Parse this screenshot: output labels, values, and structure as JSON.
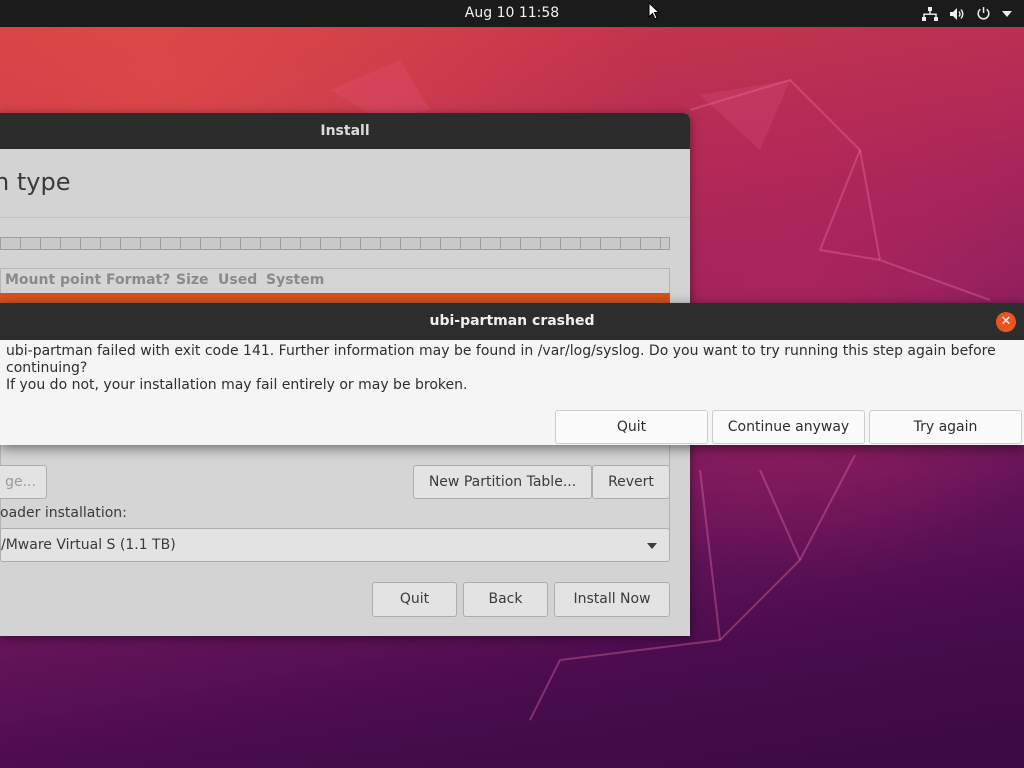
{
  "topbar": {
    "clock": "Aug 10  11:58",
    "icons": [
      "network-icon",
      "volume-icon",
      "power-icon",
      "chevron-down-icon"
    ]
  },
  "install_window": {
    "title": "Install",
    "heading": "n type",
    "table_headers": [
      "Mount point",
      "Format?",
      "Size",
      "Used",
      "System"
    ],
    "change_button": "ge...",
    "new_partition_table_button": "New Partition Table...",
    "revert_button": "Revert",
    "bootloader_label": "oader installation:",
    "bootloader_device": "/Mware Virtual S (1.1 TB)",
    "quit_button": "Quit",
    "back_button": "Back",
    "install_now_button": "Install Now"
  },
  "crash_dialog": {
    "title": "ubi-partman crashed",
    "message_line1": "ubi-partman failed with exit code 141. Further information may be found in /var/log/syslog. Do you want to try running this step again before continuing?",
    "message_line2": "If you do not, your installation may fail entirely or may be broken.",
    "quit_button": "Quit",
    "continue_button": "Continue anyway",
    "try_again_button": "Try again",
    "close_symbol": "✕"
  },
  "colors": {
    "accent": "#e95420",
    "selected_row": "#d7521d",
    "titlebar": "#2c2c2c"
  }
}
